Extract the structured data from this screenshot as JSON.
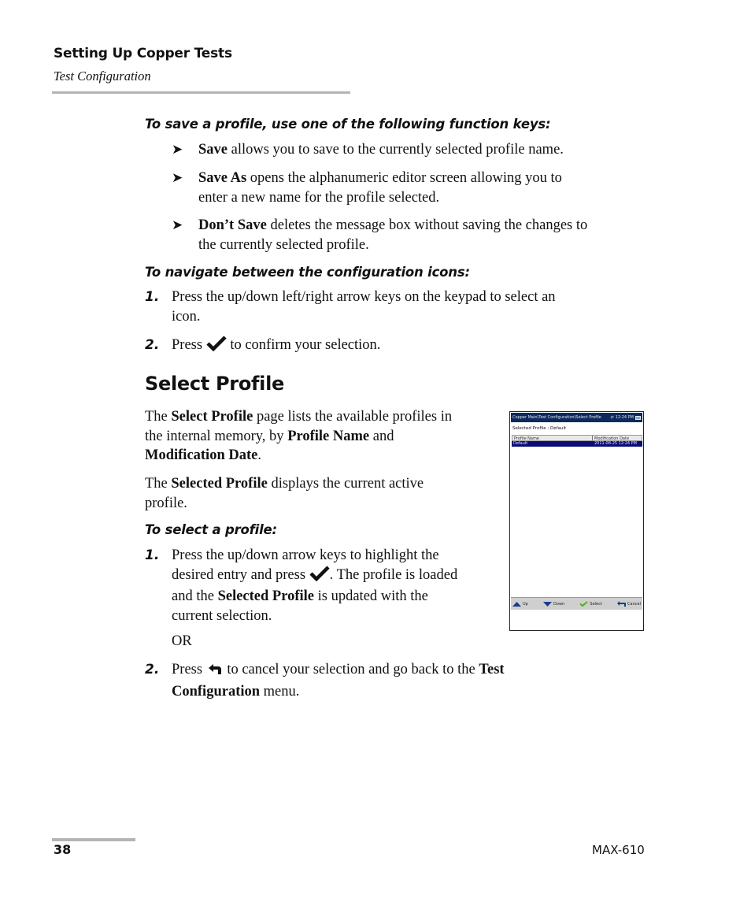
{
  "header": {
    "chapter_title": "Setting Up Copper Tests",
    "section_title": "Test Configuration"
  },
  "save_profile": {
    "heading": "To save a profile, use one of the following function keys:",
    "bullets": [
      {
        "bold": "Save",
        "text": " allows you to save to the currently selected profile name."
      },
      {
        "bold": "Save As",
        "text": " opens the alphanumeric editor screen allowing you to",
        "text2": "enter a new name for the profile selected."
      },
      {
        "bold": "Don’t Save",
        "text": " deletes the message box without saving the changes to",
        "text2": "the currently selected profile."
      }
    ]
  },
  "navigate": {
    "heading": "To navigate between the configuration icons:",
    "steps": [
      {
        "num": "1.",
        "line1": "Press the up/down left/right arrow keys on the keypad to select an",
        "line2": "icon."
      },
      {
        "num": "2.",
        "pre": "Press ",
        "icon": "checkmark-icon",
        "post": " to confirm your selection."
      }
    ]
  },
  "select_profile": {
    "title": "Select Profile",
    "para1": {
      "t1": "The ",
      "b1": "Select Profile",
      "t2": " page lists the available profiles in",
      "t3": "the internal memory, by ",
      "b2": "Profile Name",
      "t4": " and",
      "b3": "Modification Date",
      "t5": "."
    },
    "para2": {
      "t1": "The ",
      "b1": "Selected Profile",
      "t2": " displays the current active",
      "t3": "profile."
    },
    "procedure_heading": "To select a profile:",
    "steps": [
      {
        "num": "1.",
        "l1": "Press the up/down arrow keys to highlight the",
        "l2a": "desired entry and press ",
        "l2b": ". The profile is loaded",
        "l3a": "and the ",
        "l3b": "Selected Profile",
        "l3c": " is updated with the",
        "l4": "current selection."
      },
      {
        "or": "OR"
      },
      {
        "num": "2.",
        "l1a": "Press ",
        "l1b": " to cancel your selection and go back to the ",
        "l1c": "Test",
        "l2a": "Configuration",
        "l2b": " menu."
      }
    ]
  },
  "device_screen": {
    "breadcrumb": "Copper Main\\Test Configuration\\Select Profile",
    "clock": "12:24 PM",
    "selected_profile_label": "Selected Profile : Default",
    "table": {
      "columns": [
        "Profile Name",
        "Modification Date"
      ],
      "rows": [
        {
          "name": "Default",
          "date": "2011-08-25 12:24 PM"
        }
      ]
    },
    "function_keys": [
      {
        "label": "Up",
        "icon": "up-arrow-icon"
      },
      {
        "label": "Down",
        "icon": "down-arrow-icon"
      },
      {
        "label": "Select",
        "icon": "checkmark-icon"
      },
      {
        "label": "Cancel",
        "icon": "back-arrow-icon"
      }
    ],
    "colors": {
      "titlebar": "#0d2a5c",
      "selection": "#0b0b78",
      "fk_arrow": "#1a3a8a",
      "fk_check": "#4caf1e"
    }
  },
  "footer": {
    "page_number": "38",
    "product": "MAX-610"
  }
}
